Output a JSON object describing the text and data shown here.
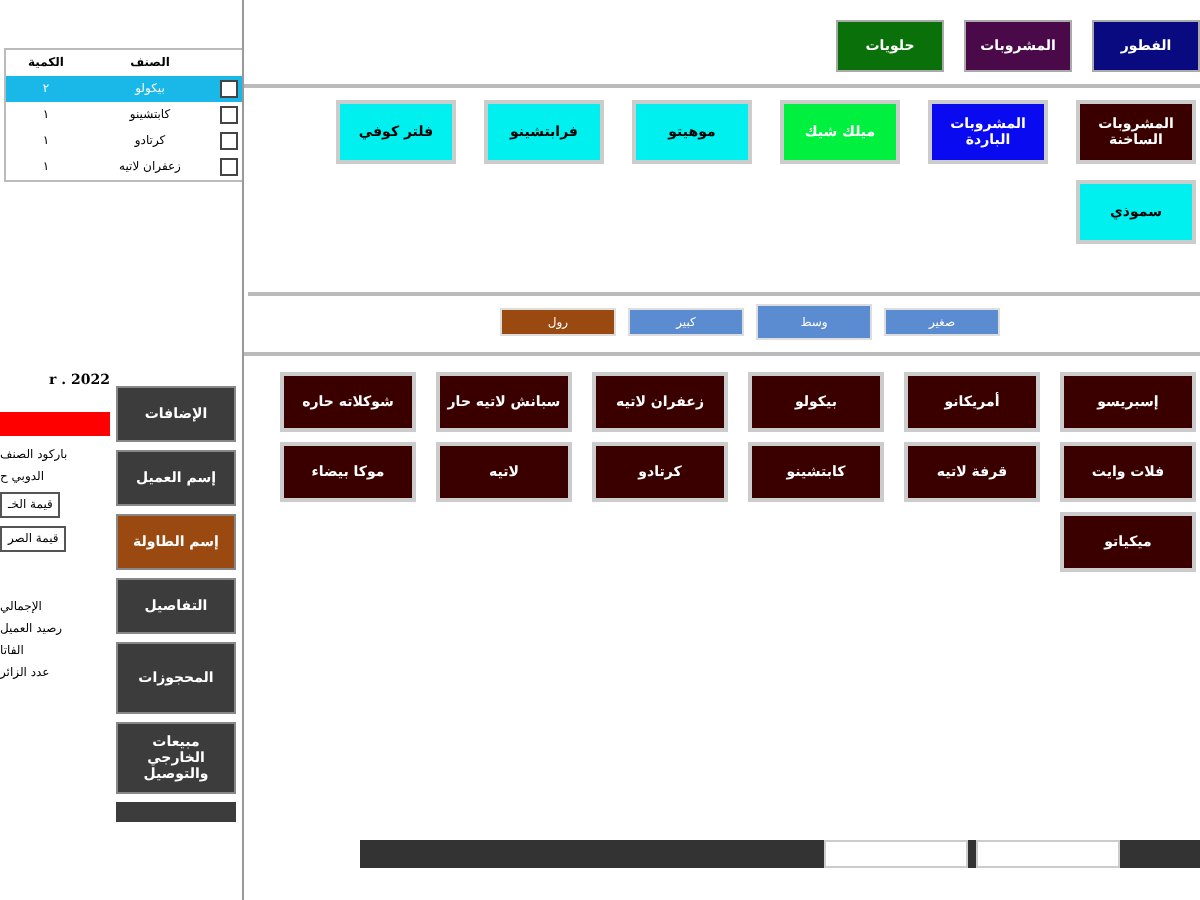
{
  "order_list": {
    "columns": [
      "الصنف",
      "الكمية"
    ],
    "rows": [
      {
        "item": "بيكولو",
        "qty": "٢",
        "selected": true,
        "checked": false
      },
      {
        "item": "كابتشينو",
        "qty": "١",
        "selected": false,
        "checked": false
      },
      {
        "item": "كرتادو",
        "qty": "١",
        "selected": false,
        "checked": false
      },
      {
        "item": "زعفران لاتيه",
        "qty": "١",
        "selected": false,
        "checked": false
      }
    ]
  },
  "info": {
    "date": "r . 2022",
    "barcode_label": "باركود الصنف",
    "label_2": "الدوبي ح",
    "field_1": "قيمة الخـ",
    "field_2": "قيمة الصر",
    "total_label": "الإجمالي",
    "balance_label": "رصيد العميل",
    "label_3": "الفاتا",
    "label_4": "عدد الزائر"
  },
  "nav_buttons": [
    {
      "label": "الإضافات",
      "selected": false
    },
    {
      "label": "إسم العميل",
      "selected": false
    },
    {
      "label": "إسم الطاولة",
      "selected": true
    },
    {
      "label": "التفاصيل",
      "selected": false
    },
    {
      "label": "المحجوزات",
      "selected": false
    },
    {
      "label": "مبيعات الخارجي والتوصيل",
      "selected": false
    }
  ],
  "categories": [
    {
      "label": "الفطور",
      "color": "#0a0a80"
    },
    {
      "label": "المشروبات",
      "color": "#4a0a4a"
    },
    {
      "label": "حلويات",
      "color": "#0a700a"
    }
  ],
  "subcategories": [
    {
      "label": "المشروبات الساخنة",
      "color": "#3a0000"
    },
    {
      "label": "المشروبات الباردة",
      "color": "#0a0af0"
    },
    {
      "label": "ميلك شيك",
      "color": "#00f040"
    },
    {
      "label": "موهيتو",
      "color": "#00f0f0"
    },
    {
      "label": "فرابتشينو",
      "color": "#00f0f0"
    },
    {
      "label": "فلتر كوفي",
      "color": "#00f0f0"
    },
    {
      "label": "سموذي",
      "color": "#00f0f0"
    }
  ],
  "sizes": [
    {
      "label": "صغير",
      "selected": false,
      "color": "#5b8bd0"
    },
    {
      "label": "وسط",
      "selected": true,
      "color": "#5b8bd0"
    },
    {
      "label": "كبير",
      "selected": false,
      "color": "#5b8bd0"
    },
    {
      "label": "رول",
      "selected": false,
      "color": "#9a4a10"
    }
  ],
  "items": [
    "إسبريسو",
    "أمريكانو",
    "بيكولو",
    "زعفران لاتيه",
    "سبانش لاتيه حار",
    "شوكلاته حاره",
    "فلات وايت",
    "قرفة لاتيه",
    "كابتشينو",
    "كرتادو",
    "لاتيه",
    "موكا بيضاء",
    "ميكياتو"
  ]
}
